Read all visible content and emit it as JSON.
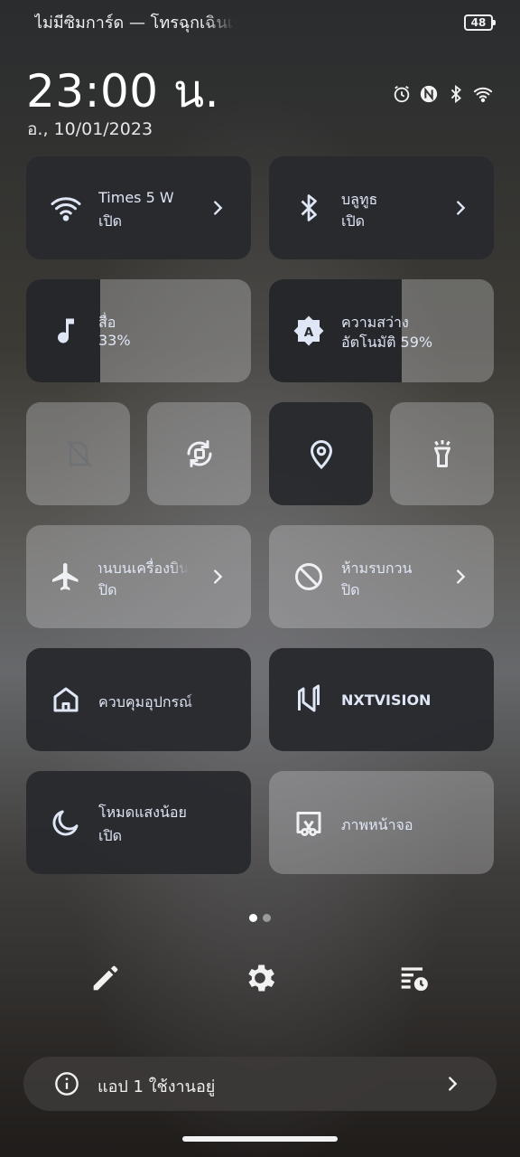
{
  "status_bar": {
    "carrier_text": "ไม่มีซิมการ์ด — โทรฉุกเฉินเท่านั้น",
    "battery_level": "48",
    "icons": [
      "alarm-icon",
      "nfc-icon",
      "bluetooth-icon",
      "wifi-icon"
    ]
  },
  "header": {
    "time": "23:00 น.",
    "date": "อ., 10/01/2023"
  },
  "tiles": {
    "wifi": {
      "title": "Times 5 W",
      "status": "เปิด",
      "icon": "wifi-icon",
      "active": true
    },
    "bluetooth": {
      "title": "บลูทูธ",
      "status": "เปิด",
      "icon": "bluetooth-icon",
      "active": true
    },
    "media": {
      "title": "สื่อ",
      "value": "33%",
      "icon": "music-note-icon",
      "level": 0.33
    },
    "brightness": {
      "title": "ความสว่าง",
      "value": "อัตโนมัติ 59%",
      "icon": "auto-brightness-icon",
      "level": 0.59
    },
    "sim": {
      "icon": "no-sim-icon",
      "active": false
    },
    "rotate": {
      "icon": "auto-rotate-icon",
      "active": false
    },
    "location": {
      "icon": "location-icon",
      "active": true
    },
    "flashlight": {
      "icon": "flashlight-icon",
      "active": false
    },
    "airplane": {
      "title": "โหมดใช้งานบนเครื่องบิน",
      "status": "ปิด",
      "icon": "airplane-icon",
      "active": false
    },
    "dnd": {
      "title": "ห้ามรบกวน",
      "status": "ปิด",
      "icon": "do-not-disturb-icon",
      "active": false
    },
    "home": {
      "title": "ควบคุมอุปกรณ์",
      "icon": "home-icon",
      "active": true
    },
    "nxtvision": {
      "title": "NXTVISION",
      "icon": "nxtvision-icon",
      "active": true
    },
    "night": {
      "title": "โหมดแสงน้อย",
      "status": "เปิด",
      "icon": "moon-icon",
      "active": true
    },
    "screenshot": {
      "title": "ภาพหน้าจอ",
      "icon": "screenshot-icon",
      "active": false
    }
  },
  "pager": {
    "pages": 2,
    "current": 1
  },
  "bottom_actions": [
    "edit-icon",
    "settings-icon",
    "running-apps-icon"
  ],
  "notice": {
    "text": "แอป 1 ใช้งานอยู่",
    "icon": "info-icon"
  },
  "colors": {
    "tile_dark": "#2a2c30",
    "icon_color": "#dfe6f5"
  }
}
